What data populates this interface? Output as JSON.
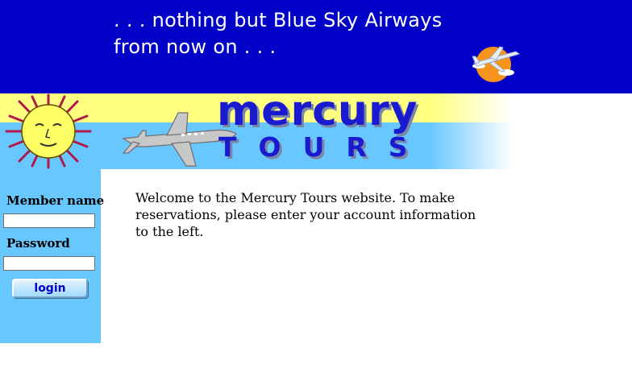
{
  "header": {
    "tagline_line1": ". . . nothing but Blue Sky Airways",
    "tagline_line2": "from now on . . ."
  },
  "logo": {
    "title": "mercury",
    "subtitle": "TOURS"
  },
  "login_form": {
    "member_name_label": "Member name",
    "member_name_value": "",
    "password_label": "Password",
    "password_value": "",
    "login_button_label": "login"
  },
  "main": {
    "welcome_text": "Welcome to the Mercury Tours website. To make reservations, please enter your account information to the left."
  },
  "icons": {
    "header_badge": "airplane-sun-icon",
    "sun": "sun-face-icon",
    "banner_plane": "airplane-icon"
  },
  "colors": {
    "header_bg": "#0000c6",
    "sidebar_bg": "#69c7ff",
    "banner_yellow": "#ffff80",
    "logo_blue": "#1a1ad0"
  }
}
